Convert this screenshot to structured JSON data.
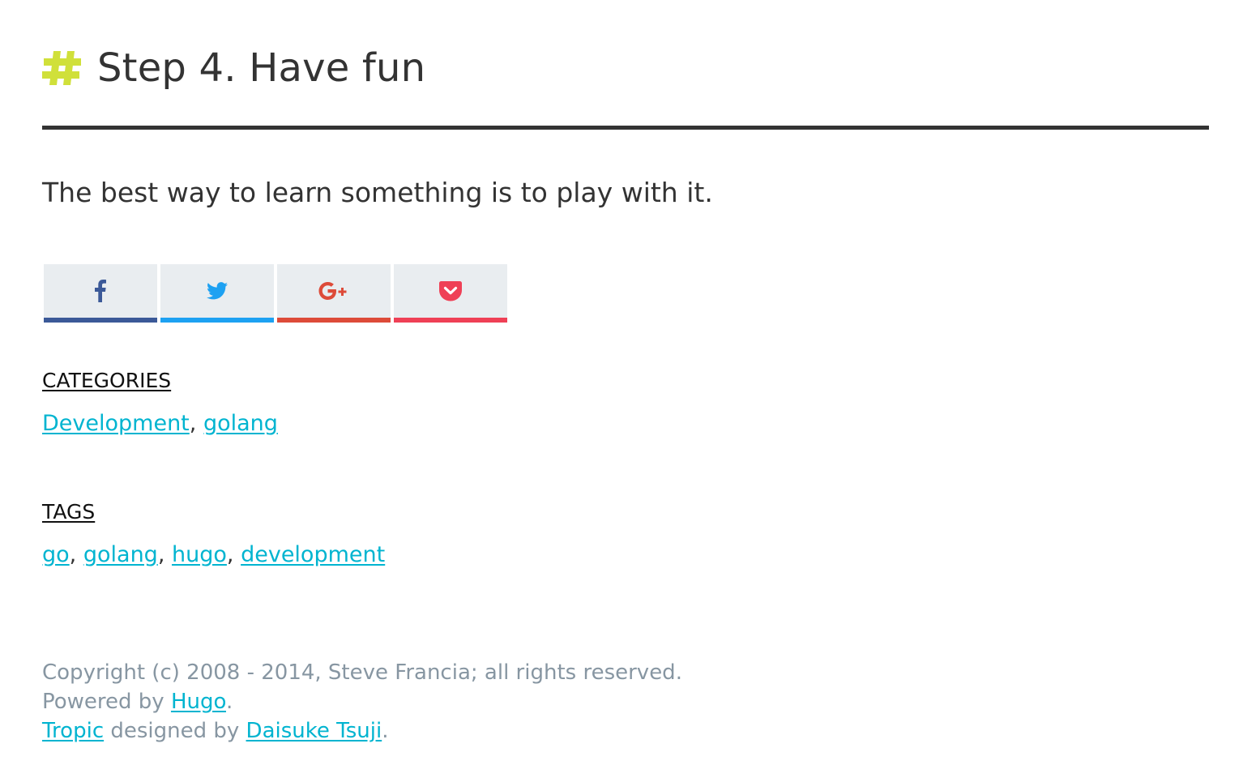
{
  "heading": {
    "title": "Step 4. Have fun",
    "icon": "hash-icon",
    "icon_color": "#d0e03a"
  },
  "lead_text": "The best way to learn something is to play with it.",
  "share": [
    {
      "name": "facebook",
      "icon": "facebook-icon",
      "color": "#3b5998"
    },
    {
      "name": "twitter",
      "icon": "twitter-icon",
      "color": "#1da1f2"
    },
    {
      "name": "google-plus",
      "icon": "google-plus-icon",
      "color": "#dd4b39"
    },
    {
      "name": "pocket",
      "icon": "pocket-icon",
      "color": "#ef4056"
    }
  ],
  "categories": {
    "title": "CATEGORIES",
    "items": [
      "Development",
      "golang"
    ]
  },
  "tags": {
    "title": "TAGS",
    "items": [
      "go",
      "golang",
      "hugo",
      "development"
    ]
  },
  "separator": ",",
  "footer": {
    "copyright": "Copyright (c) 2008 - 2014, Steve Francia; all rights reserved.",
    "powered_prefix": "Powered by ",
    "powered_link": "Hugo",
    "period": ".",
    "theme_link": "Tropic",
    "designed_by": " designed by ",
    "designer_link": "Daisuke Tsuji"
  },
  "colors": {
    "link": "#00b4d0",
    "text": "#333333",
    "muted": "#8796a2",
    "share_bg": "#e9edf0"
  }
}
